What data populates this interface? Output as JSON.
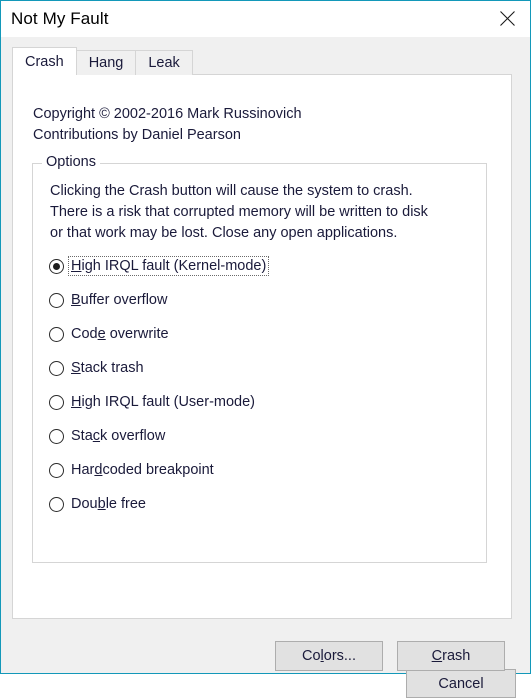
{
  "window": {
    "title": "Not My Fault",
    "close_icon": "close-icon",
    "accent_color": "#1398b9",
    "titlebar_bg": "#ffffff",
    "client_bg": "#f0f0f0",
    "panel_bg": "#ffffff",
    "text_color": "#1a1a3a",
    "button_bg": "#e1e1e1",
    "button_border": "#adadad"
  },
  "tabs": [
    {
      "label": "Crash",
      "active": true
    },
    {
      "label": "Hang",
      "active": false
    },
    {
      "label": "Leak",
      "active": false
    }
  ],
  "crash_tab": {
    "copyright_line1": "Copyright © 2002-2016 Mark Russinovich",
    "copyright_line2": "Contributions by Daniel Pearson",
    "options": {
      "legend": "Options",
      "description_line1": "Clicking the Crash button will cause the system to crash.",
      "description_line2": "There is a risk that corrupted memory will be written to disk",
      "description_line3": "or that work may be lost. Close any open applications.",
      "selected_index": 0,
      "items": [
        {
          "label": "High IRQL fault (Kernel-mode)",
          "accel": "H",
          "accel_index": 0,
          "checked": true
        },
        {
          "label": "Buffer overflow",
          "accel": "B",
          "accel_index": 0,
          "checked": false
        },
        {
          "label": "Code overwrite",
          "accel": "d",
          "accel_index": 3,
          "checked": false
        },
        {
          "label": "Stack trash",
          "accel": "S",
          "accel_index": 0,
          "checked": false
        },
        {
          "label": "High IRQL fault (User-mode)",
          "accel": "H",
          "accel_index": 0,
          "checked": false
        },
        {
          "label": "Stack overflow",
          "accel": "a",
          "accel_index": 3,
          "checked": false
        },
        {
          "label": "Hardcoded breakpoint",
          "accel": "r",
          "accel_index": 3,
          "checked": false
        },
        {
          "label": "Double free",
          "accel": "u",
          "accel_index": 3,
          "checked": false
        }
      ]
    },
    "colors_button": {
      "label": "Colors...",
      "accel_index": 2
    },
    "crash_button": {
      "label": "Crash",
      "accel_index": 0
    }
  },
  "footer": {
    "cancel_button": {
      "label": "Cancel",
      "accel_index": -1
    }
  }
}
